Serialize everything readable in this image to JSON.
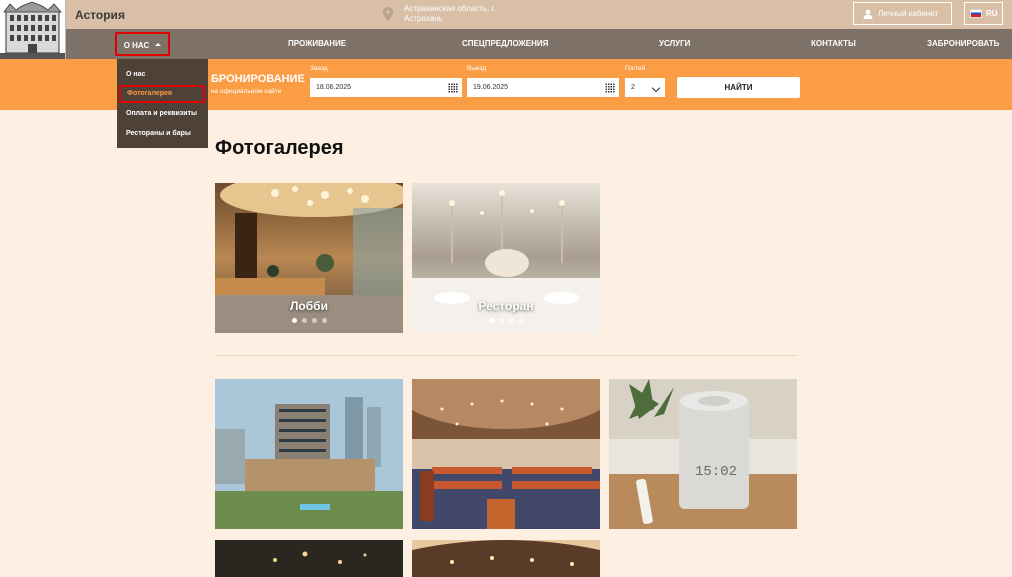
{
  "header": {
    "brand": "Астория",
    "location_line1": "Астраханская область, г.",
    "location_line2": "Астрахань",
    "cabinet_label": "Личный кабинет",
    "lang": "RU"
  },
  "nav": {
    "about": "О НАС",
    "accommodation": "ПРОЖИВАНИЕ",
    "offers": "СПЕЦПРЕДЛОЖЕНИЯ",
    "services": "УСЛУГИ",
    "contacts": "КОНТАКТЫ",
    "book": "ЗАБРОНИРОВАТЬ"
  },
  "dropdown": {
    "items": [
      "О нас",
      "Фотогалерея",
      "Оплата и реквизиты",
      "Рестораны и бары"
    ]
  },
  "booking": {
    "title": "БРОНИРОВАНИЕ",
    "subtitle": "на официальном сайте",
    "checkin_label": "Заезд",
    "checkin_value": "18.06.2025",
    "checkout_label": "Выезд",
    "checkout_value": "19.06.2025",
    "guests_label": "Гостей",
    "guests_value": "2",
    "find_button": "НАЙТИ"
  },
  "page": {
    "title": "Фотогалерея"
  },
  "gallery": {
    "cards": [
      {
        "label": "Лобби",
        "dots": 4,
        "active_dot": 0
      },
      {
        "label": "Ресторан",
        "dots": 4,
        "active_dot": 0
      }
    ]
  },
  "colors": {
    "accent": "#fb9d45",
    "nav_bg": "#7d7168",
    "topbar_bg": "#d8bfa6",
    "dropdown_bg": "#4e4138",
    "highlight": "#e00000"
  }
}
